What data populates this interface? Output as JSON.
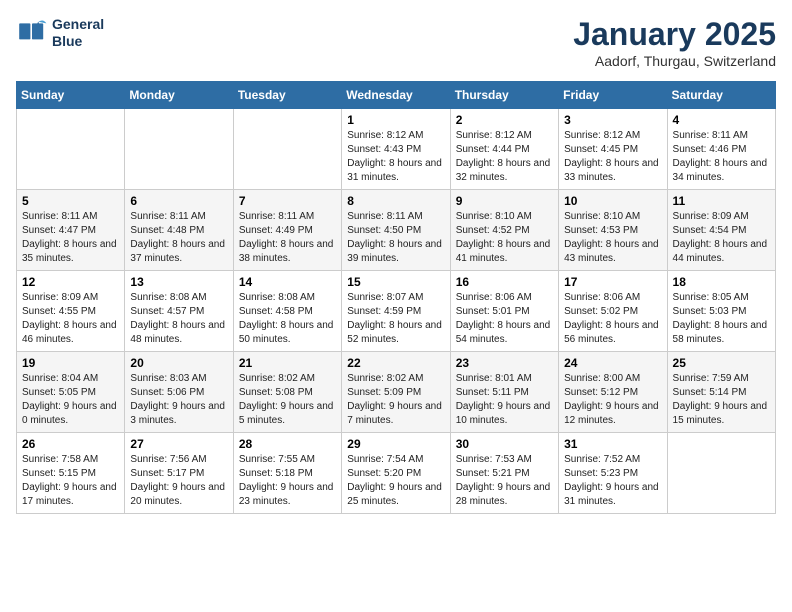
{
  "logo": {
    "line1": "General",
    "line2": "Blue"
  },
  "title": "January 2025",
  "subtitle": "Aadorf, Thurgau, Switzerland",
  "days_header": [
    "Sunday",
    "Monday",
    "Tuesday",
    "Wednesday",
    "Thursday",
    "Friday",
    "Saturday"
  ],
  "weeks": [
    [
      {
        "day": "",
        "sunrise": "",
        "sunset": "",
        "daylight": ""
      },
      {
        "day": "",
        "sunrise": "",
        "sunset": "",
        "daylight": ""
      },
      {
        "day": "",
        "sunrise": "",
        "sunset": "",
        "daylight": ""
      },
      {
        "day": "1",
        "sunrise": "Sunrise: 8:12 AM",
        "sunset": "Sunset: 4:43 PM",
        "daylight": "Daylight: 8 hours and 31 minutes."
      },
      {
        "day": "2",
        "sunrise": "Sunrise: 8:12 AM",
        "sunset": "Sunset: 4:44 PM",
        "daylight": "Daylight: 8 hours and 32 minutes."
      },
      {
        "day": "3",
        "sunrise": "Sunrise: 8:12 AM",
        "sunset": "Sunset: 4:45 PM",
        "daylight": "Daylight: 8 hours and 33 minutes."
      },
      {
        "day": "4",
        "sunrise": "Sunrise: 8:11 AM",
        "sunset": "Sunset: 4:46 PM",
        "daylight": "Daylight: 8 hours and 34 minutes."
      }
    ],
    [
      {
        "day": "5",
        "sunrise": "Sunrise: 8:11 AM",
        "sunset": "Sunset: 4:47 PM",
        "daylight": "Daylight: 8 hours and 35 minutes."
      },
      {
        "day": "6",
        "sunrise": "Sunrise: 8:11 AM",
        "sunset": "Sunset: 4:48 PM",
        "daylight": "Daylight: 8 hours and 37 minutes."
      },
      {
        "day": "7",
        "sunrise": "Sunrise: 8:11 AM",
        "sunset": "Sunset: 4:49 PM",
        "daylight": "Daylight: 8 hours and 38 minutes."
      },
      {
        "day": "8",
        "sunrise": "Sunrise: 8:11 AM",
        "sunset": "Sunset: 4:50 PM",
        "daylight": "Daylight: 8 hours and 39 minutes."
      },
      {
        "day": "9",
        "sunrise": "Sunrise: 8:10 AM",
        "sunset": "Sunset: 4:52 PM",
        "daylight": "Daylight: 8 hours and 41 minutes."
      },
      {
        "day": "10",
        "sunrise": "Sunrise: 8:10 AM",
        "sunset": "Sunset: 4:53 PM",
        "daylight": "Daylight: 8 hours and 43 minutes."
      },
      {
        "day": "11",
        "sunrise": "Sunrise: 8:09 AM",
        "sunset": "Sunset: 4:54 PM",
        "daylight": "Daylight: 8 hours and 44 minutes."
      }
    ],
    [
      {
        "day": "12",
        "sunrise": "Sunrise: 8:09 AM",
        "sunset": "Sunset: 4:55 PM",
        "daylight": "Daylight: 8 hours and 46 minutes."
      },
      {
        "day": "13",
        "sunrise": "Sunrise: 8:08 AM",
        "sunset": "Sunset: 4:57 PM",
        "daylight": "Daylight: 8 hours and 48 minutes."
      },
      {
        "day": "14",
        "sunrise": "Sunrise: 8:08 AM",
        "sunset": "Sunset: 4:58 PM",
        "daylight": "Daylight: 8 hours and 50 minutes."
      },
      {
        "day": "15",
        "sunrise": "Sunrise: 8:07 AM",
        "sunset": "Sunset: 4:59 PM",
        "daylight": "Daylight: 8 hours and 52 minutes."
      },
      {
        "day": "16",
        "sunrise": "Sunrise: 8:06 AM",
        "sunset": "Sunset: 5:01 PM",
        "daylight": "Daylight: 8 hours and 54 minutes."
      },
      {
        "day": "17",
        "sunrise": "Sunrise: 8:06 AM",
        "sunset": "Sunset: 5:02 PM",
        "daylight": "Daylight: 8 hours and 56 minutes."
      },
      {
        "day": "18",
        "sunrise": "Sunrise: 8:05 AM",
        "sunset": "Sunset: 5:03 PM",
        "daylight": "Daylight: 8 hours and 58 minutes."
      }
    ],
    [
      {
        "day": "19",
        "sunrise": "Sunrise: 8:04 AM",
        "sunset": "Sunset: 5:05 PM",
        "daylight": "Daylight: 9 hours and 0 minutes."
      },
      {
        "day": "20",
        "sunrise": "Sunrise: 8:03 AM",
        "sunset": "Sunset: 5:06 PM",
        "daylight": "Daylight: 9 hours and 3 minutes."
      },
      {
        "day": "21",
        "sunrise": "Sunrise: 8:02 AM",
        "sunset": "Sunset: 5:08 PM",
        "daylight": "Daylight: 9 hours and 5 minutes."
      },
      {
        "day": "22",
        "sunrise": "Sunrise: 8:02 AM",
        "sunset": "Sunset: 5:09 PM",
        "daylight": "Daylight: 9 hours and 7 minutes."
      },
      {
        "day": "23",
        "sunrise": "Sunrise: 8:01 AM",
        "sunset": "Sunset: 5:11 PM",
        "daylight": "Daylight: 9 hours and 10 minutes."
      },
      {
        "day": "24",
        "sunrise": "Sunrise: 8:00 AM",
        "sunset": "Sunset: 5:12 PM",
        "daylight": "Daylight: 9 hours and 12 minutes."
      },
      {
        "day": "25",
        "sunrise": "Sunrise: 7:59 AM",
        "sunset": "Sunset: 5:14 PM",
        "daylight": "Daylight: 9 hours and 15 minutes."
      }
    ],
    [
      {
        "day": "26",
        "sunrise": "Sunrise: 7:58 AM",
        "sunset": "Sunset: 5:15 PM",
        "daylight": "Daylight: 9 hours and 17 minutes."
      },
      {
        "day": "27",
        "sunrise": "Sunrise: 7:56 AM",
        "sunset": "Sunset: 5:17 PM",
        "daylight": "Daylight: 9 hours and 20 minutes."
      },
      {
        "day": "28",
        "sunrise": "Sunrise: 7:55 AM",
        "sunset": "Sunset: 5:18 PM",
        "daylight": "Daylight: 9 hours and 23 minutes."
      },
      {
        "day": "29",
        "sunrise": "Sunrise: 7:54 AM",
        "sunset": "Sunset: 5:20 PM",
        "daylight": "Daylight: 9 hours and 25 minutes."
      },
      {
        "day": "30",
        "sunrise": "Sunrise: 7:53 AM",
        "sunset": "Sunset: 5:21 PM",
        "daylight": "Daylight: 9 hours and 28 minutes."
      },
      {
        "day": "31",
        "sunrise": "Sunrise: 7:52 AM",
        "sunset": "Sunset: 5:23 PM",
        "daylight": "Daylight: 9 hours and 31 minutes."
      },
      {
        "day": "",
        "sunrise": "",
        "sunset": "",
        "daylight": ""
      }
    ]
  ]
}
